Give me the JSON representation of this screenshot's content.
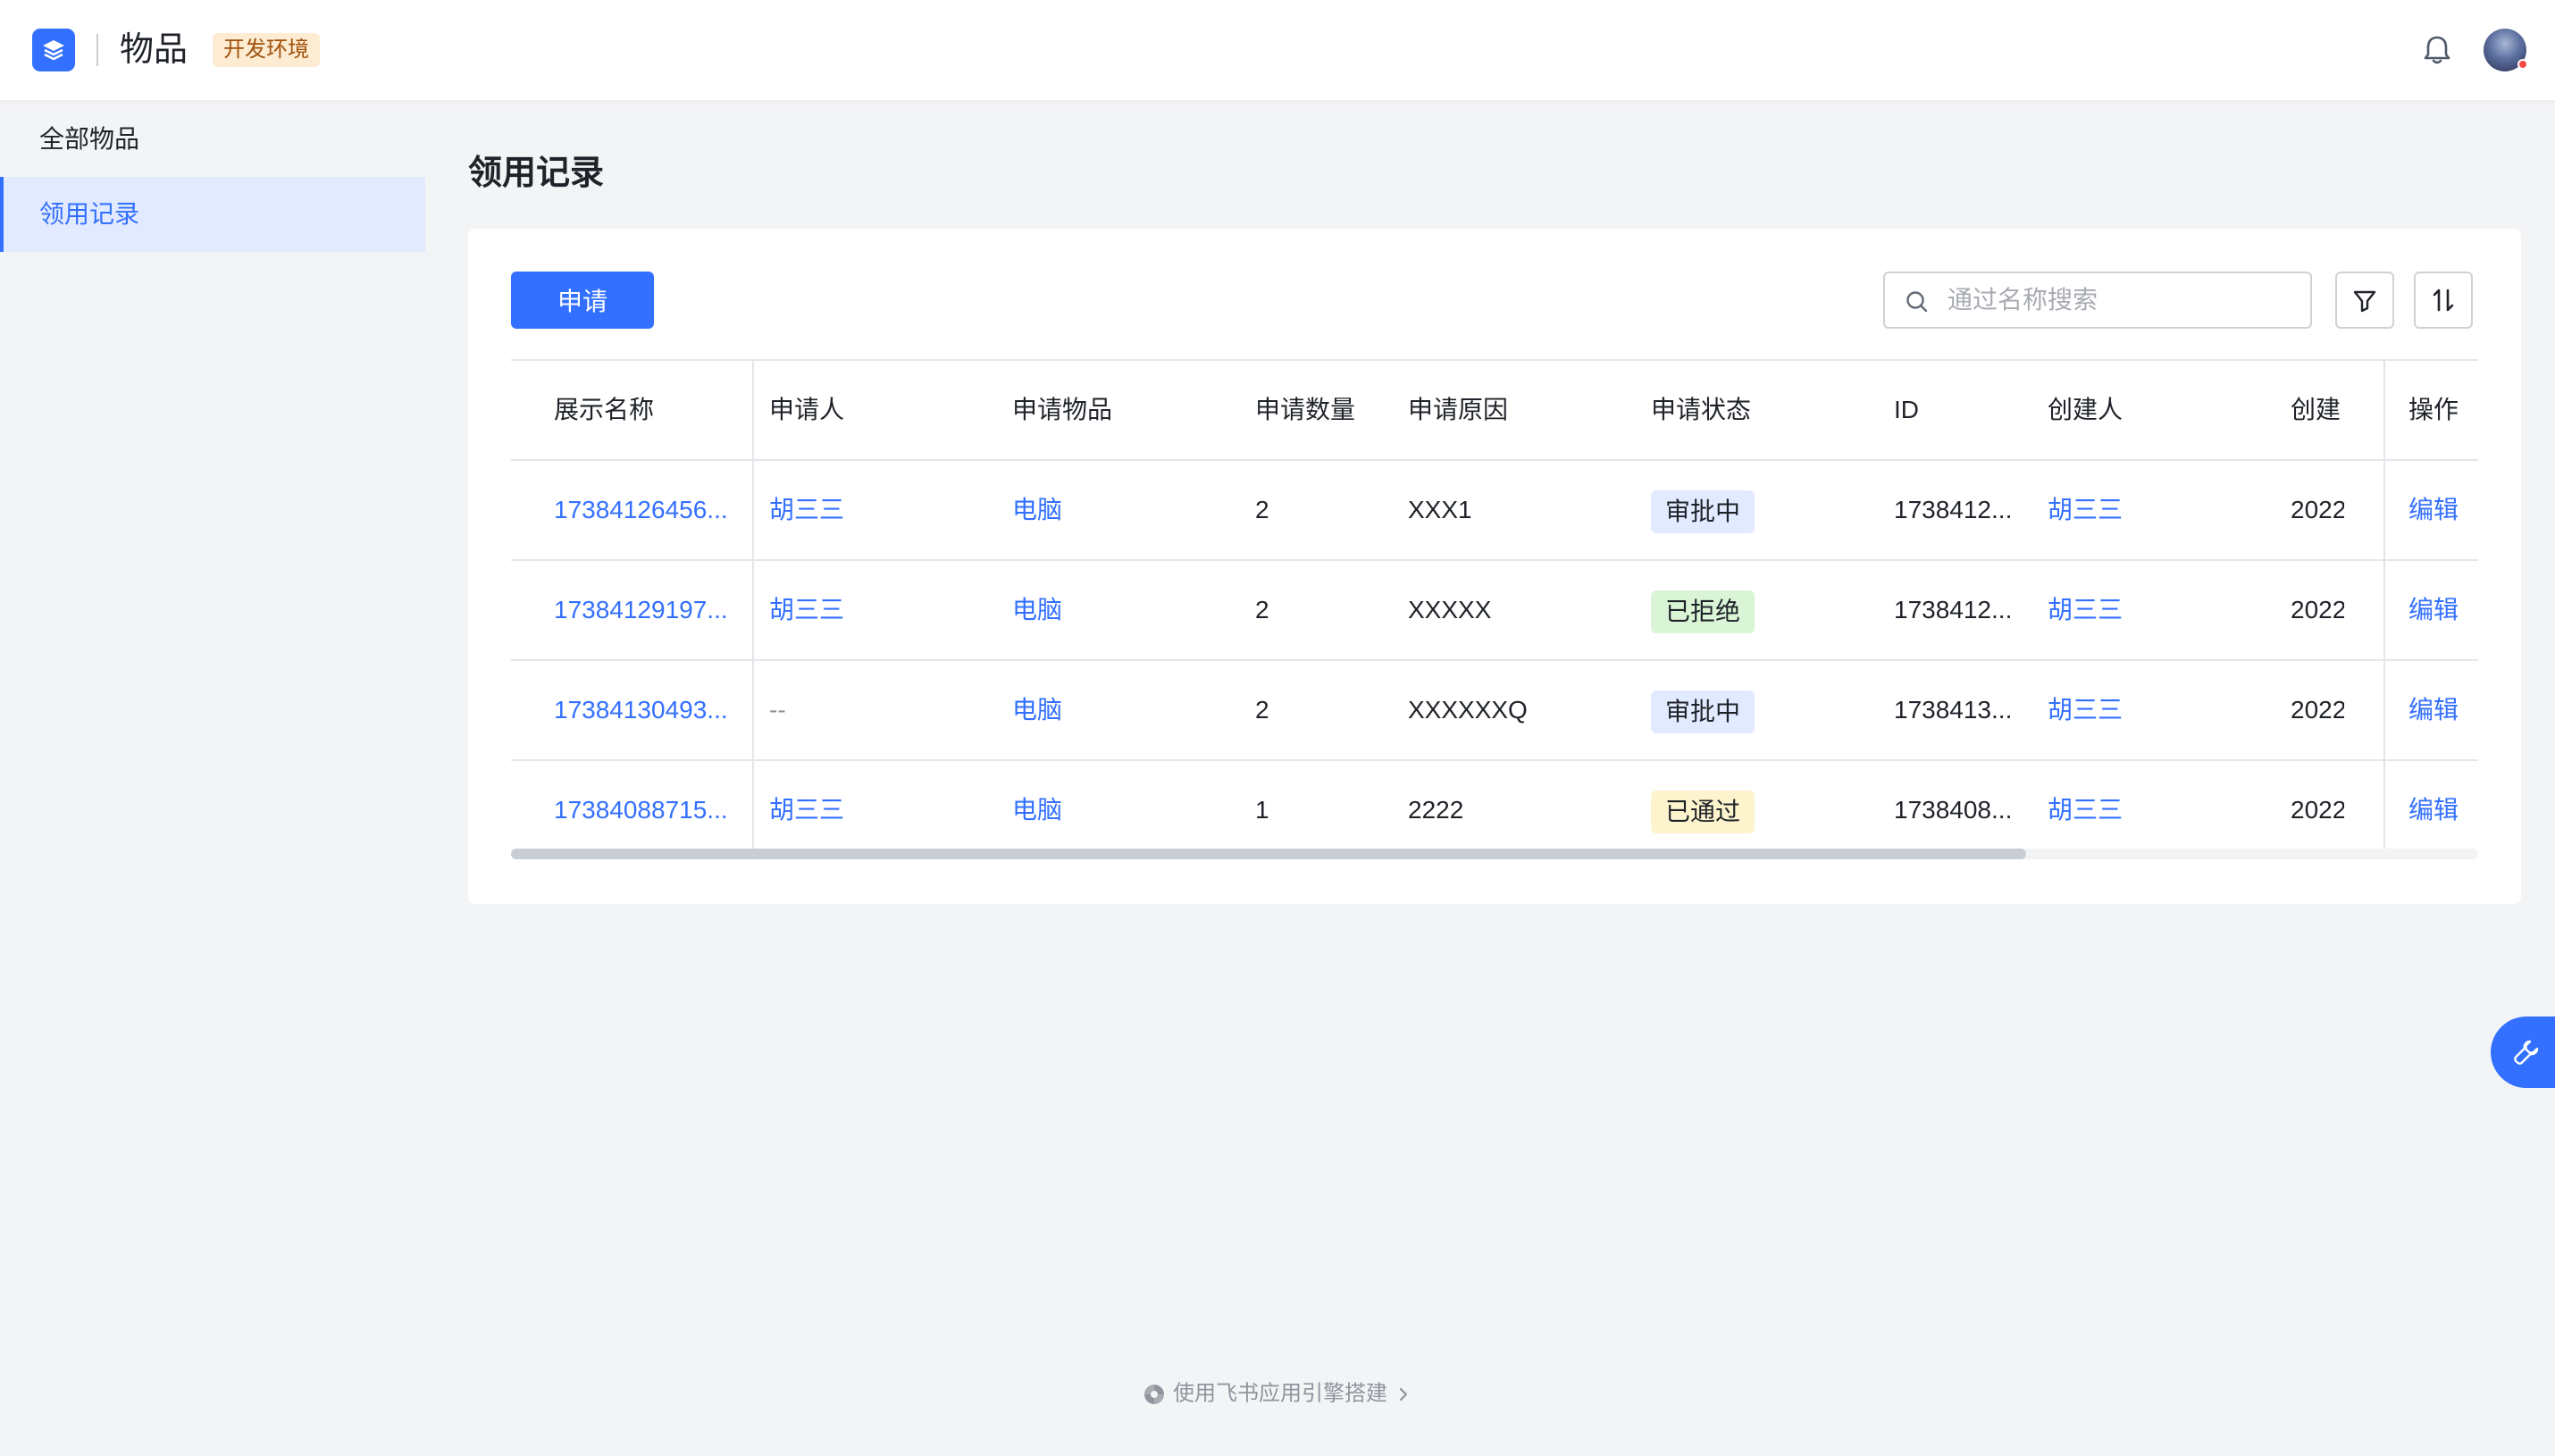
{
  "header": {
    "app_title": "物品",
    "env_badge": "开发环境",
    "logo_icon": "layers-icon",
    "bell_icon": "bell-icon",
    "accent": "#3370ff"
  },
  "sidebar": {
    "items": [
      {
        "label": "全部物品",
        "active": false
      },
      {
        "label": "领用记录",
        "active": true
      }
    ]
  },
  "main": {
    "page_title": "领用记录",
    "apply_button": "申请",
    "search_placeholder": "通过名称搜索",
    "filter_icon": "filter-icon",
    "sort_icon": "sort-icon"
  },
  "table": {
    "columns": [
      "展示名称",
      "申请人",
      "申请物品",
      "申请数量",
      "申请原因",
      "申请状态",
      "ID",
      "创建人",
      "创建",
      "操作"
    ],
    "rows": [
      {
        "name": "17384126456...",
        "applicant": "胡三三",
        "item": "电脑",
        "qty": "2",
        "reason": "XXX1",
        "status": "审批中",
        "status_color": "blue",
        "id": "1738412...",
        "creator": "胡三三",
        "created": "2022",
        "action": "编辑"
      },
      {
        "name": "17384129197...",
        "applicant": "胡三三",
        "item": "电脑",
        "qty": "2",
        "reason": "XXXXX",
        "status": "已拒绝",
        "status_color": "green",
        "id": "1738412...",
        "creator": "胡三三",
        "created": "2022",
        "action": "编辑"
      },
      {
        "name": "17384130493...",
        "applicant": "--",
        "item": "电脑",
        "qty": "2",
        "reason": "XXXXXXQ",
        "status": "审批中",
        "status_color": "blue",
        "id": "1738413...",
        "creator": "胡三三",
        "created": "2022",
        "action": "编辑"
      },
      {
        "name": "17384088715...",
        "applicant": "胡三三",
        "item": "电脑",
        "qty": "1",
        "reason": "2222",
        "status": "已通过",
        "status_color": "yellow",
        "id": "1738408...",
        "creator": "胡三三",
        "created": "2022",
        "action": "编辑"
      }
    ]
  },
  "floating": {
    "icon": "wrench-icon"
  },
  "footer": {
    "text": "使用飞书应用引擎搭建",
    "icon": "feishu-logo-icon",
    "chevron": "chevron-right-icon"
  }
}
